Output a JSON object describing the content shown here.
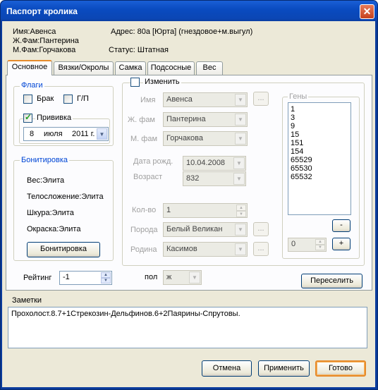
{
  "window": {
    "title": "Паспорт кролика"
  },
  "header": {
    "name": "Имя:Авенса",
    "father": "Ж.Фам:Пантерина",
    "mother": "М.Фам:Горчакова",
    "address": "Адрес:  80а [Юрта] (гнездовое+м.выгул)",
    "status": "Статус: Штатная"
  },
  "tabs": [
    "Основное",
    "Вязки/Окролы",
    "Самка",
    "Подсосные",
    "Вес"
  ],
  "flags": {
    "group_title": "Флаги",
    "brak_label": "Брак",
    "gp_label": "Г/П",
    "privivka_label": "Прививка",
    "date_day": "8",
    "date_month": "июля",
    "date_year": "2011 г."
  },
  "bonitirovka": {
    "group_title": "Бонитировка",
    "items": [
      "Вес:Элита",
      "Телосложение:Элита",
      "Шкура:Элита",
      "Окраска:Элита"
    ],
    "button": "Бонитировка"
  },
  "rating": {
    "label": "Рейтинг",
    "value": "-1"
  },
  "edit": {
    "change_label": "Изменить",
    "name_label": "Имя",
    "name_value": "Авенса",
    "father_label": "Ж. фам",
    "father_value": "Пантерина",
    "mother_label": "М. фам",
    "mother_value": "Горчакова",
    "birth_label": "Дата рожд.",
    "birth_value": "10.04.2008",
    "age_label": "Возраст",
    "age_value": "832",
    "count_label": "Кол-во",
    "count_value": "1",
    "breed_label": "Порода",
    "breed_value": "Белый Великан",
    "origin_label": "Родина",
    "origin_value": "Касимов",
    "ellipsis": "...",
    "sex_label": "пол",
    "sex_value": "ж"
  },
  "genes": {
    "group_title": "Гены",
    "items": [
      "1",
      "3",
      "9",
      "15",
      "151",
      "154",
      "65529",
      "65530",
      "65532"
    ],
    "spin_value": "0",
    "minus": "-",
    "plus": "+"
  },
  "resettle_button": "Переселить",
  "notes": {
    "label": "Заметки",
    "text": "Прохолост.8.7+1Стрекозин-Дельфинов.6+2Паярины-Спрутовы."
  },
  "buttons": {
    "cancel": "Отмена",
    "apply": "Применить",
    "ok": "Готово"
  }
}
